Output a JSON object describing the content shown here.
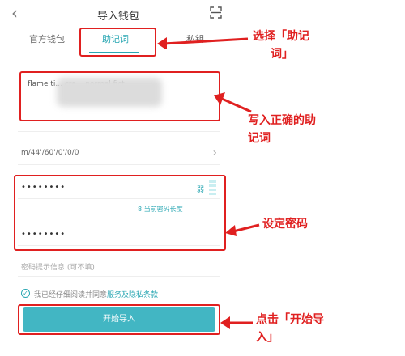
{
  "header": {
    "title": "导入钱包",
    "back_icon": "chevron-left-icon",
    "scan_icon": "scan-icon"
  },
  "tabs": [
    {
      "label": "官方钱包"
    },
    {
      "label": "助记词"
    },
    {
      "label": "私钥"
    }
  ],
  "mnemonic": {
    "visible_text": "flame ti... cre... normal fict"
  },
  "path": {
    "value": "m/44'/60'/0'/0/0"
  },
  "password": {
    "dots": "••••••••",
    "strength": "弱",
    "hint": "8 当前密码长度",
    "confirm_dots": "••••••••"
  },
  "password_hint": {
    "placeholder": "密码提示信息 (可不填)"
  },
  "agree": {
    "text": "我已经仔细阅读并同意",
    "link": "服务及隐私条款"
  },
  "import_button": {
    "label": "开始导入"
  },
  "annotations": {
    "a1": "选择「助记",
    "a1b": "词」",
    "a2": "写入正确的助",
    "a2b": "记词",
    "a3": "设定密码",
    "a4": "点击「开始导",
    "a4b": "入」"
  },
  "colors": {
    "accent": "#2aa7b3",
    "button": "#42b6c3",
    "annotation": "#e02020"
  }
}
